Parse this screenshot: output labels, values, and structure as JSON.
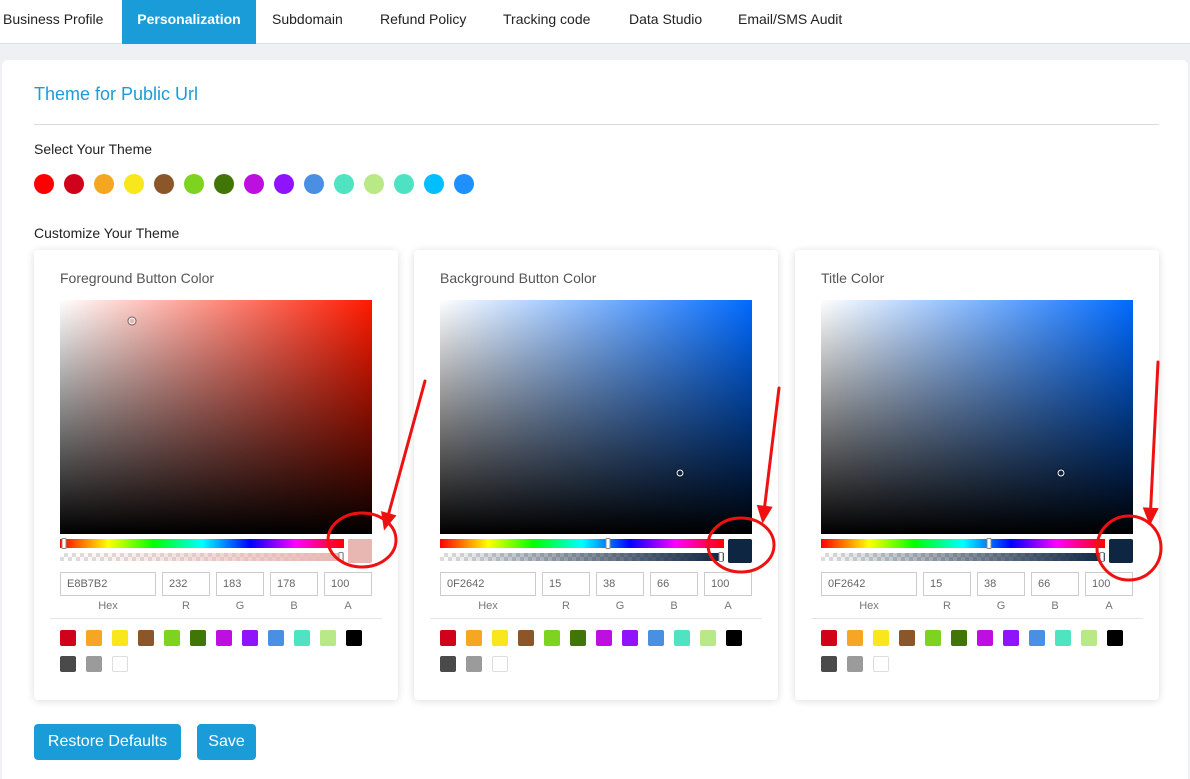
{
  "tabs": [
    {
      "label": "Business Profile",
      "active": false
    },
    {
      "label": "Personalization",
      "active": true
    },
    {
      "label": "Subdomain",
      "active": false
    },
    {
      "label": "Refund Policy",
      "active": false
    },
    {
      "label": "Tracking code",
      "active": false
    },
    {
      "label": "Data Studio",
      "active": false
    },
    {
      "label": "Email/SMS Audit",
      "active": false
    }
  ],
  "page": {
    "title": "Theme for Public Url",
    "select_label": "Select Your Theme",
    "customize_label": "Customize Your Theme"
  },
  "theme_colors": [
    "#ff0000",
    "#d0021b",
    "#f5a623",
    "#f8e71c",
    "#8b572a",
    "#7ed321",
    "#417505",
    "#bd10e0",
    "#9013fe",
    "#4a90e2",
    "#50e3c2",
    "#b8e986",
    "#4de3c2",
    "#00bfff",
    "#1e90ff"
  ],
  "field_labels": {
    "hex": "Hex",
    "r": "R",
    "g": "G",
    "b": "B",
    "a": "A"
  },
  "pickers": [
    {
      "title": "Foreground Button Color",
      "hue_color": "#ff1a00",
      "swatch_color": "#e8b7b2",
      "hex": "E8B7B2",
      "r": "232",
      "g": "183",
      "b": "178",
      "a": "100",
      "saturation": 0.23,
      "brightness": 0.91,
      "hue_fraction": 0.015,
      "alpha": 1.0
    },
    {
      "title": "Background Button Color",
      "hue_color": "#006aff",
      "swatch_color": "#0f2642",
      "hex": "0F2642",
      "r": "15",
      "g": "38",
      "b": "66",
      "a": "100",
      "saturation": 0.77,
      "brightness": 0.26,
      "hue_fraction": 0.59,
      "alpha": 1.0
    },
    {
      "title": "Title Color",
      "hue_color": "#006aff",
      "swatch_color": "#0f2642",
      "hex": "0F2642",
      "r": "15",
      "g": "38",
      "b": "66",
      "a": "100",
      "saturation": 0.77,
      "brightness": 0.26,
      "hue_fraction": 0.59,
      "alpha": 1.0
    }
  ],
  "preset_colors": [
    "#d0021b",
    "#f5a623",
    "#f8e71c",
    "#8b572a",
    "#7ed321",
    "#417505",
    "#bd10e0",
    "#9013fe",
    "#4a90e2",
    "#50e3c2",
    "#b8e986",
    "#000000",
    "#4a4a4a",
    "#9b9b9b",
    "#ffffff"
  ],
  "buttons": {
    "restore": "Restore Defaults",
    "save": "Save"
  },
  "annotation_color": "#ee1111"
}
